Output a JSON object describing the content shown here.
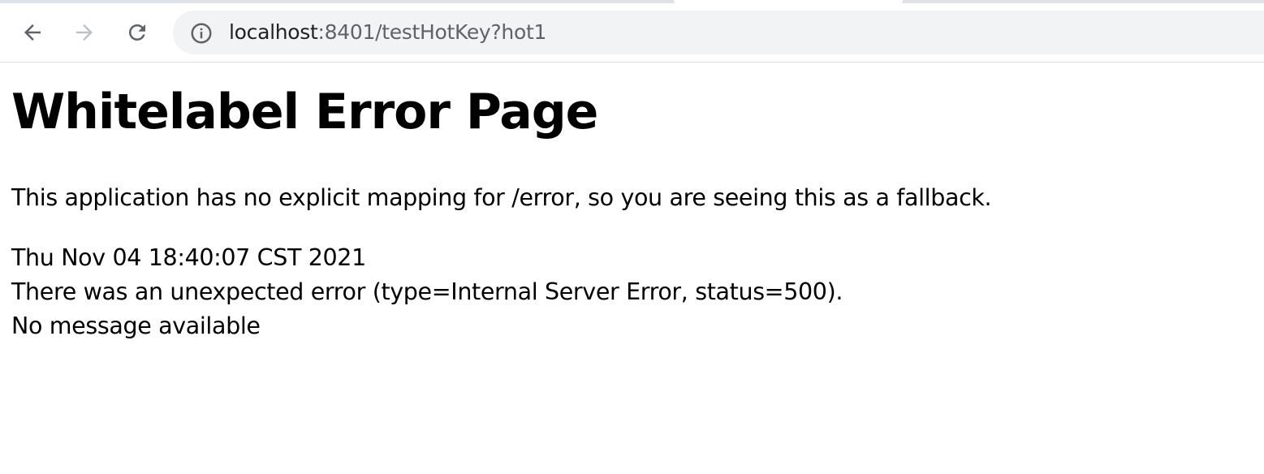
{
  "browser": {
    "address_bar": {
      "url_host": "localhost",
      "url_rest": ":8401/testHotKey?hot1"
    }
  },
  "page": {
    "title": "Whitelabel Error Page",
    "description": "This application has no explicit mapping for /error, so you are seeing this as a fallback.",
    "timestamp": "Thu Nov 04 18:40:07 CST 2021",
    "error_line": "There was an unexpected error (type=Internal Server Error, status=500).",
    "message": "No message available"
  },
  "colors": {
    "toolbar_bg": "#ffffff",
    "omnibox_bg": "#f1f3f4",
    "icon_active": "#5f6368",
    "icon_disabled": "#bdc1c6",
    "url_host": "#202124",
    "url_rest": "#5f6368"
  },
  "icons": {
    "back": "arrow-left-icon",
    "forward": "arrow-right-icon",
    "reload": "reload-icon",
    "site_info": "info-icon"
  }
}
